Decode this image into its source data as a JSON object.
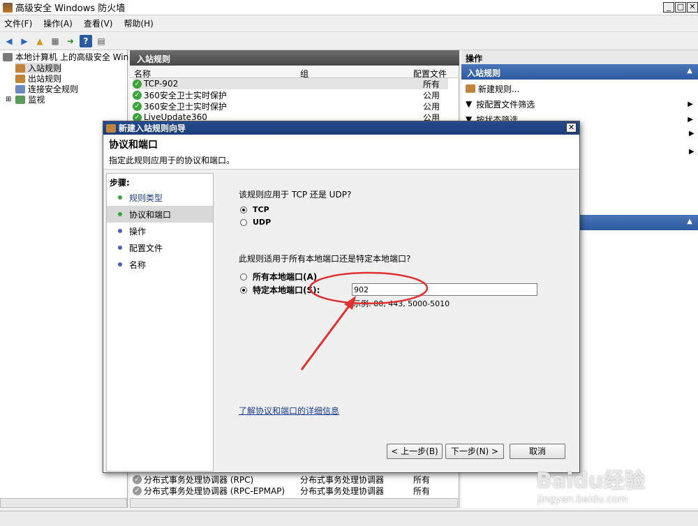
{
  "window": {
    "title": "高级安全 Windows 防火墙",
    "min": "_",
    "max": "□",
    "close": "✕"
  },
  "menu": [
    "文件(F)",
    "操作(A)",
    "查看(V)",
    "帮助(H)"
  ],
  "tree": {
    "root": "本地计算机 上的高级安全 Win",
    "items": [
      "入站规则",
      "出站规则",
      "连接安全规则",
      "监视"
    ]
  },
  "center": {
    "header": "入站规则",
    "columns": [
      "名称",
      "组",
      "配置文件"
    ],
    "rows_top": [
      {
        "name": "TCP-902",
        "group": "",
        "profile": "所有"
      },
      {
        "name": "360安全卫士实时保护",
        "group": "",
        "profile": "公用"
      },
      {
        "name": "360安全卫士实时保护",
        "group": "",
        "profile": "公用"
      },
      {
        "name": "LiveUpdate360",
        "group": "",
        "profile": "公用"
      }
    ],
    "rows_bottom": [
      {
        "name": "分布式事务处理协调器 (RPC)",
        "group": "分布式事务处理协调器",
        "profile": "所有"
      },
      {
        "name": "分布式事务处理协调器 (RPC-EPMAP)",
        "group": "分布式事务处理协调器",
        "profile": "所有"
      }
    ]
  },
  "actions": {
    "header": "操作",
    "section": "入站规则",
    "items": [
      "新建规则...",
      "按配置文件筛选",
      "按状态筛选"
    ]
  },
  "dialog": {
    "title": "新建入站规则向导",
    "heading": "协议和端口",
    "subheading": "指定此规则应用于的协议和端口。",
    "steps_title": "步骤:",
    "steps": [
      "规则类型",
      "协议和端口",
      "操作",
      "配置文件",
      "名称"
    ],
    "q1": "该规则应用于 TCP 还是 UDP?",
    "tcp": "TCP",
    "udp": "UDP",
    "q2": "此规则适用于所有本地端口还是特定本地端口?",
    "all_ports": "所有本地端口(A)",
    "specific_ports": "特定本地端口(S):",
    "port_value": "902",
    "example": "示例: 80, 443, 5000-5010",
    "link": "了解协议和端口的详细信息",
    "back": "< 上一步(B)",
    "next": "下一步(N) >",
    "cancel": "取消"
  },
  "watermark": {
    "brand": "Baidu经验",
    "url": "jingyan.baidu.com"
  },
  "colors": {
    "accent_red": "#e03030",
    "title_blue": "#244a8e",
    "check_green": "#3aa33a"
  }
}
